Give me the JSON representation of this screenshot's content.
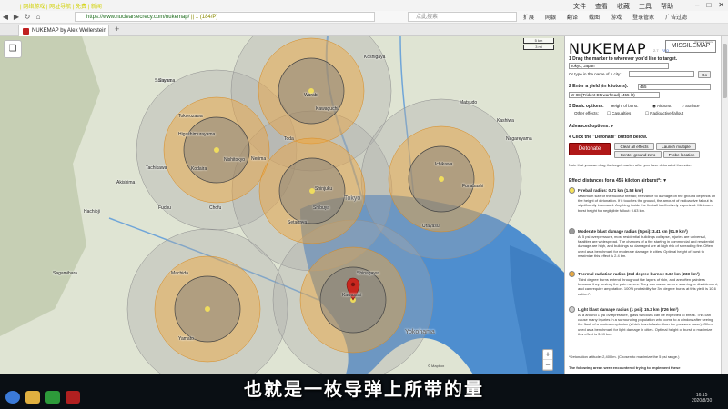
{
  "browser": {
    "title_text": "| 网络游戏 | 网址导航 | 免费 | 新闻",
    "menu": [
      "文件",
      "查看",
      "收藏",
      "工具",
      "帮助"
    ],
    "url": "https://www.nuclearsecrecy.com/nukemap/",
    "url_tail": "|| 1 (184/P)",
    "search_placeholder": "点此搜索",
    "right_items": [
      "扩展",
      "网银",
      "翻译",
      "截图",
      "游戏",
      "登录管家",
      "广告过滤"
    ],
    "tab_title": "NUKEMAP by Alex Wellerstein"
  },
  "map": {
    "scale": [
      "5 km",
      "3 mi"
    ],
    "labels": [
      {
        "t": "Tokorozawa"
      },
      {
        "t": "Higashimurayama"
      },
      {
        "t": "Kodaira"
      },
      {
        "t": "Nishitokyo"
      },
      {
        "t": "Tachikawa"
      },
      {
        "t": "Akishima"
      },
      {
        "t": "Fuchu"
      },
      {
        "t": "Chofu"
      },
      {
        "t": "Hachioji"
      },
      {
        "t": "Sagamihara"
      },
      {
        "t": "Machida"
      },
      {
        "t": "Yamato"
      },
      {
        "t": "Saitama"
      },
      {
        "t": "Warabi"
      },
      {
        "t": "Kawaguchi"
      },
      {
        "t": "Toda"
      },
      {
        "t": "Koshigaya"
      },
      {
        "t": "Ichikawa"
      },
      {
        "t": "Funabashi"
      },
      {
        "t": "Urayasu"
      },
      {
        "t": "Tokyo"
      },
      {
        "t": "Shinjuku"
      },
      {
        "t": "Setagaya"
      },
      {
        "t": "Shibuya"
      },
      {
        "t": "Kawasaki"
      },
      {
        "t": "Yokohama"
      },
      {
        "t": "Matsudo"
      },
      {
        "t": "Nerima"
      },
      {
        "t": "Sayama"
      },
      {
        "t": "Kashiwa"
      },
      {
        "t": "Nagareyama"
      },
      {
        "t": "Shinagawa"
      }
    ],
    "zoom_in": "+",
    "zoom_out": "−",
    "credit": "© Mapbox",
    "watermark": "三川",
    "watermark_sub": "227670"
  },
  "panel": {
    "brand": "NUKEMAP",
    "version": "2.7",
    "faq": "FAQ",
    "missile_caption": "the next step to",
    "missile": "MISSILEMAP",
    "step1": "1  Drag the marker to wherever you'd like to target.",
    "city_value": "Tokyo, Japan",
    "city_hint": "Or type in the name of a city:",
    "go": "Go",
    "step2": "2  Enter a yield (in kilotons):",
    "yield_value": "455",
    "preset_value": "W-88 (Trident D5 warhead) (455 kt)",
    "step3": "3  Basic options:",
    "height_label": "Height of burst:",
    "airburst": "Airburst",
    "surface": "Surface",
    "other_effects": "Other effects:",
    "casualties": "Casualties",
    "fallout": "Radioactive fallout",
    "advanced": "Advanced options: ▸",
    "step4": "4  Click the \"Detonate\" button below.",
    "detonate": "Detonate",
    "clear": "Clear all effects",
    "launch": "Launch multiple",
    "center": "Center ground zero",
    "probe": "Probe location",
    "note": "Note that you can drag the target marker after you have detonated the nuke.",
    "effects_header": "Effect distances for a 455 kiloton airburst*: ▼",
    "effects": [
      {
        "title": "Fireball radius: 0.71 km (1.58 km²)",
        "color": "#f6e25a",
        "text": "Maximum size of the nuclear fireball; relevance to damage on the ground depends on the height of detonation. If it touches the ground, the amount of radioactive fallout is significantly increased. Anything inside the fireball is effectively vaporized. Minimum burst height for negligible fallout: 0.63 km."
      },
      {
        "title": "Moderate blast damage radius (5 psi): 3.41 km (91.9 km²)",
        "color": "#9a9a9a",
        "text": "At 5 psi overpressure, most residential buildings collapse, injuries are universal, fatalities are widespread. The chances of a fire starting in commercial and residential damage are high, and buildings so damaged are at high risk of spreading fire. Often used as a benchmark for moderate damage in cities. Optimal height of burst to maximize this effect is 2.4 km."
      },
      {
        "title": "Thermal radiation radius (3rd degree burns): 6.62 km (233 km²)",
        "color": "#e8a840",
        "text": "Third degree burns extend throughout the layers of skin, and are often painless because they destroy the pain nerves. They can cause severe scarring or disablement, and can require amputation. 100% probability for 3rd degree burns at this yield is 10.6 cal/cm²."
      },
      {
        "title": "Light blast damage radius (1 psi): 15.2 km (726 km²)",
        "color": "#cfcfcf",
        "text": "At a around 1 psi overpressure, glass windows can be expected to break. This can cause many injuries in a surrounding population who come to a window after seeing the flash of a nuclear explosion (which travels faster than the pressure wave). Often used as a benchmark for light damage in cities. Optimal height of burst to maximize this effect is 3.59 km."
      }
    ],
    "detonation_altitude": "*Detonation altitude: 2,400 m. (Chosen to maximize the 5 psi range.)",
    "footer_cut": "The following areas were encountered trying to implement these"
  },
  "taskbar": {
    "time": "16:15",
    "date": "2020/8/30"
  },
  "subtitle": "也就是一枚导弹上所带的量"
}
